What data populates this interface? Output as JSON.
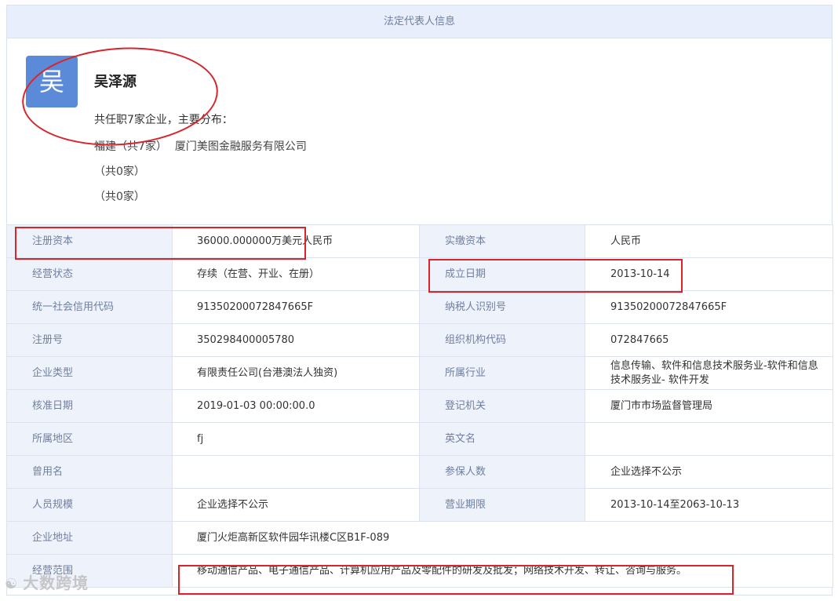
{
  "header": {
    "title": "法定代表人信息"
  },
  "person": {
    "avatar_char": "吴",
    "name": "吴泽源",
    "summary": "共任职7家企业，主要分布：",
    "distribution": [
      {
        "region": "福建（共7家）",
        "company": "厦门美图金融服务有限公司"
      },
      {
        "region": "（共0家）",
        "company": ""
      },
      {
        "region": "（共0家）",
        "company": ""
      }
    ]
  },
  "rows": [
    {
      "label1": "注册资本",
      "value1": "36000.000000万美元人民币",
      "label2": "实缴资本",
      "value2": "人民币"
    },
    {
      "label1": "经营状态",
      "value1": "存续（在营、开业、在册）",
      "label2": "成立日期",
      "value2": "2013-10-14"
    },
    {
      "label1": "统一社会信用代码",
      "value1": "91350200072847665F",
      "label2": "纳税人识别号",
      "value2": "91350200072847665F"
    },
    {
      "label1": "注册号",
      "value1": "350298400005780",
      "label2": "组织机构代码",
      "value2": "072847665"
    },
    {
      "label1": "企业类型",
      "value1": "有限责任公司(台港澳法人独资)",
      "label2": "所属行业",
      "value2": "信息传输、软件和信息技术服务业-软件和信息技术服务业- 软件开发"
    },
    {
      "label1": "核准日期",
      "value1": "2019-01-03 00:00:00.0",
      "label2": "登记机关",
      "value2": "厦门市市场监督管理局"
    },
    {
      "label1": "所属地区",
      "value1": "fj",
      "label2": "英文名",
      "value2": ""
    },
    {
      "label1": "曾用名",
      "value1": "",
      "label2": "参保人数",
      "value2": "企业选择不公示"
    },
    {
      "label1": "人员规模",
      "value1": "企业选择不公示",
      "label2": "营业期限",
      "value2": "2013-10-14至2063-10-13"
    }
  ],
  "address": {
    "label": "企业地址",
    "value": "厦门火炬高新区软件园华讯楼C区B1F-089"
  },
  "scope": {
    "label": "经营范围",
    "value": "移动通信产品、电子通信产品、计算机应用产品及零配件的研发及批发；网络技术开发、转让、咨询与服务。"
  },
  "watermark": {
    "text": "大数跨境"
  },
  "colors": {
    "annotation": "#d8252c",
    "label_bg": "#eef2fb",
    "avatar_bg": "#5b8ad8"
  }
}
